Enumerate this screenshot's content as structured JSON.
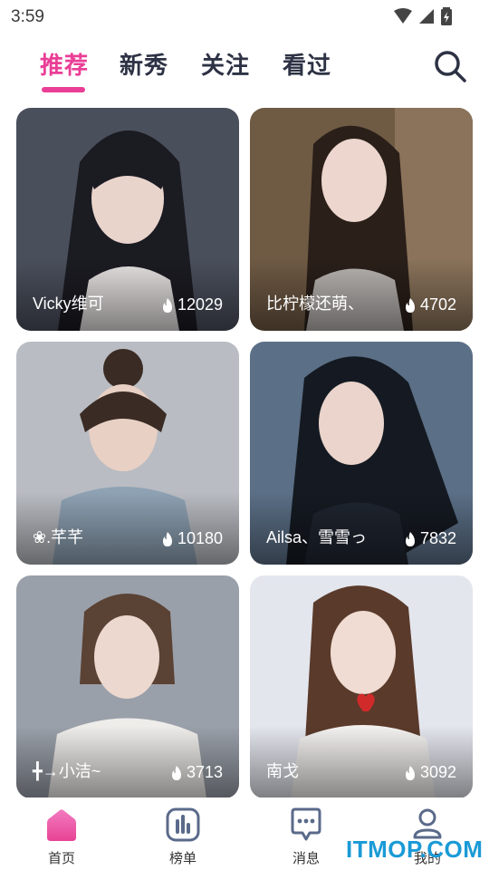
{
  "status": {
    "time": "3:59"
  },
  "tabs": [
    {
      "label": "推荐",
      "active": true
    },
    {
      "label": "新秀",
      "active": false
    },
    {
      "label": "关注",
      "active": false
    },
    {
      "label": "看过",
      "active": false
    }
  ],
  "search": {
    "icon": "search-icon"
  },
  "cards": [
    {
      "name": "Vicky维可",
      "heat": "12029"
    },
    {
      "name": "比柠檬还萌、",
      "heat": "4702"
    },
    {
      "name": "❀.芊芊",
      "heat": "10180"
    },
    {
      "name": "Ailsa、雪雪っ",
      "heat": "7832"
    },
    {
      "name": "╋→小洁~",
      "heat": "3713"
    },
    {
      "name": "南戈",
      "heat": "3092"
    }
  ],
  "nav": [
    {
      "label": "首页",
      "icon": "home-icon",
      "active": true
    },
    {
      "label": "榜单",
      "icon": "ranking-icon",
      "active": false
    },
    {
      "label": "消息",
      "icon": "message-icon",
      "active": false
    },
    {
      "label": "我的",
      "icon": "profile-icon",
      "active": false
    }
  ],
  "watermark": "ITMOP.COM",
  "colors": {
    "accent": "#ea3e96",
    "nav_icon": "#5a6a8a",
    "watermark": "#1a9ad6"
  }
}
